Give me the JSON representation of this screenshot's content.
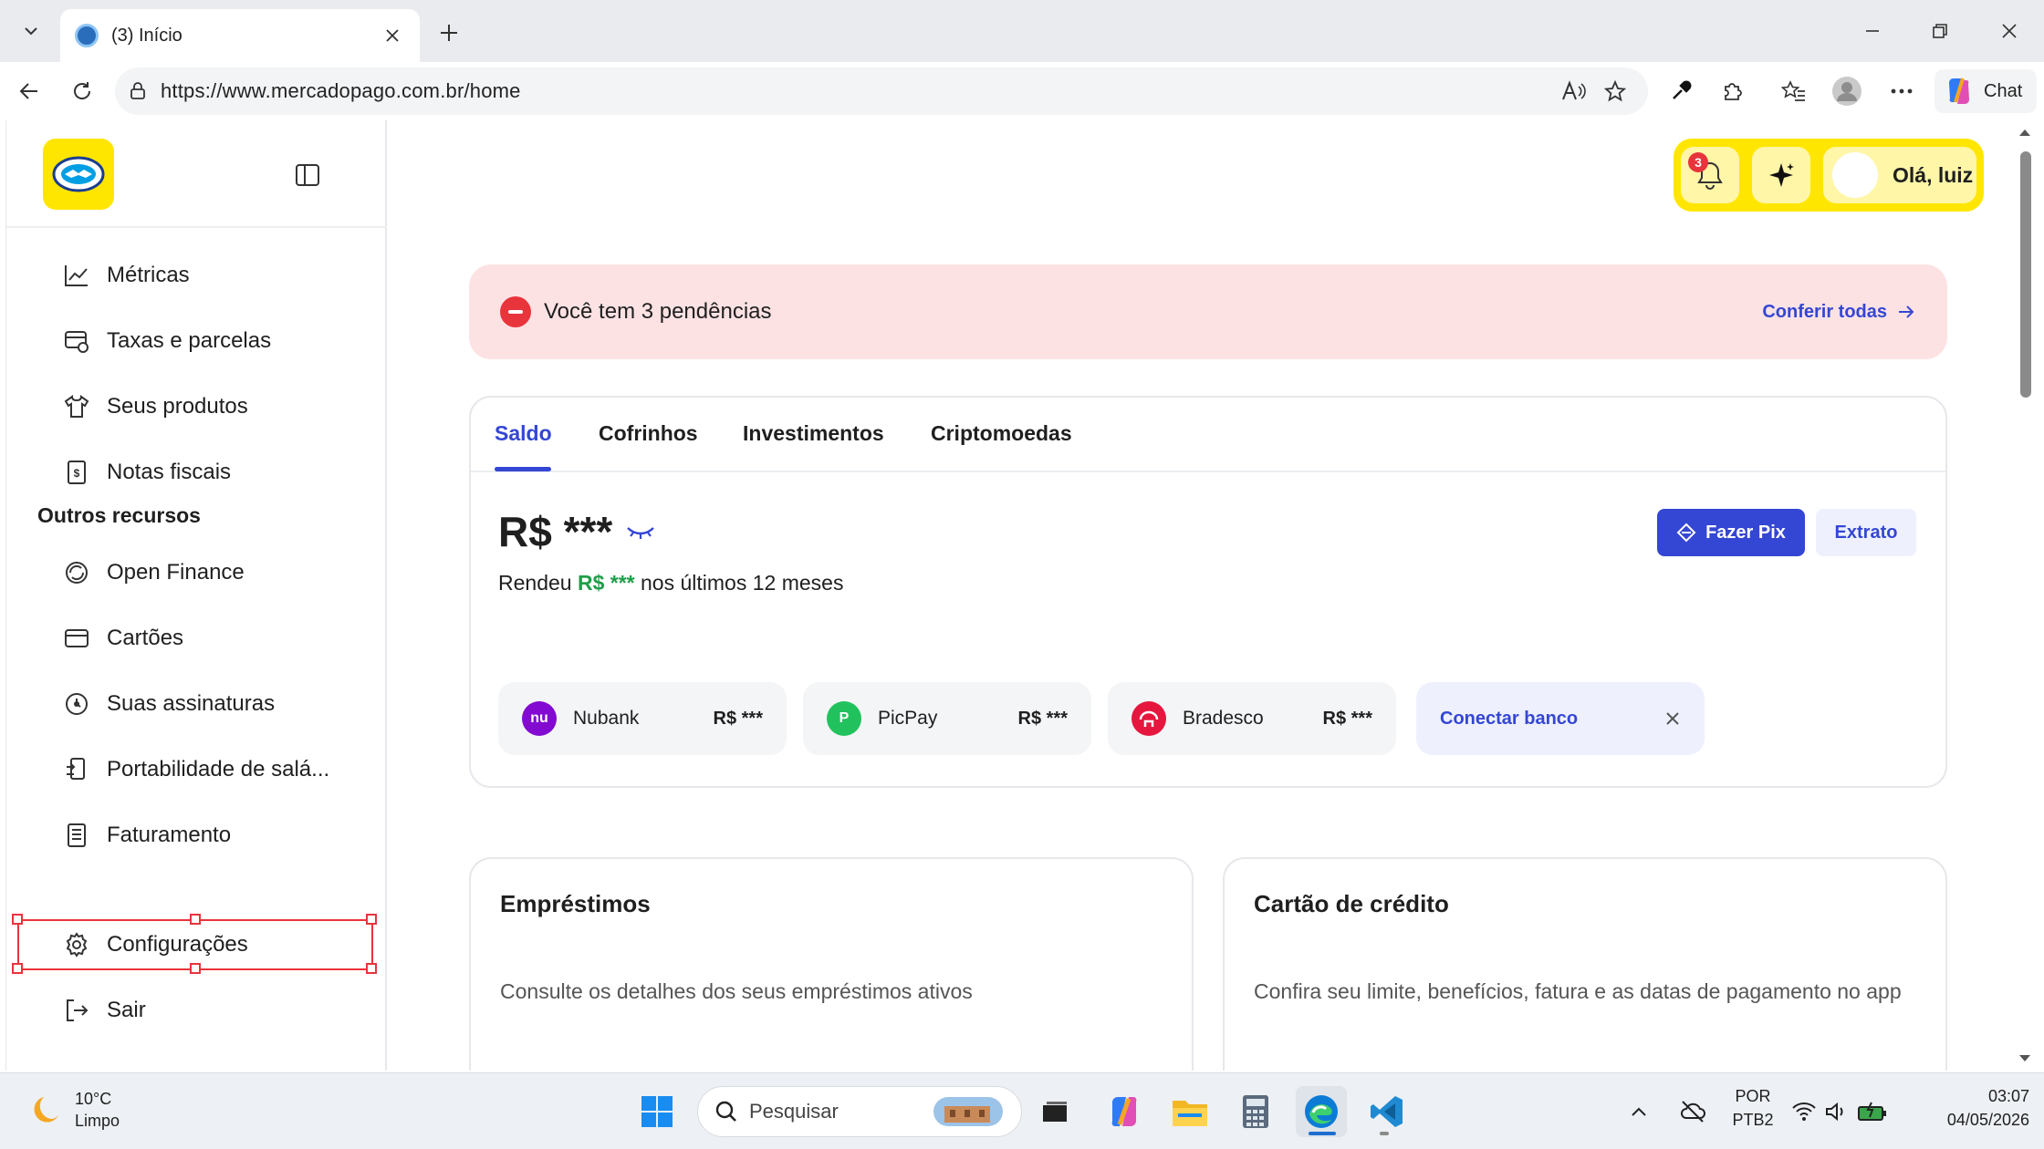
{
  "browser": {
    "tab_title": "(3) Início",
    "url": "https://www.mercadopago.com.br/home",
    "chat_label": "Chat"
  },
  "sidebar": {
    "items_top": [
      {
        "label": "Métricas",
        "icon": "chart-line-icon"
      },
      {
        "label": "Taxas e parcelas",
        "icon": "fees-icon"
      },
      {
        "label": "Seus produtos",
        "icon": "shirt-icon"
      },
      {
        "label": "Notas fiscais",
        "icon": "invoice-icon"
      }
    ],
    "section_heading": "Outros recursos",
    "items_other": [
      {
        "label": "Open Finance",
        "icon": "open-finance-icon"
      },
      {
        "label": "Cartões",
        "icon": "card-icon"
      },
      {
        "label": "Suas assinaturas",
        "icon": "subscriptions-icon"
      },
      {
        "label": "Portabilidade de salá...",
        "icon": "portability-icon"
      },
      {
        "label": "Faturamento",
        "icon": "billing-icon"
      }
    ],
    "settings_label": "Configurações",
    "logout_label": "Sair"
  },
  "header": {
    "notification_count": "3",
    "greeting": "Olá, luiz"
  },
  "alert": {
    "text": "Você tem 3 pendências",
    "link": "Conferir todas"
  },
  "balance_card": {
    "tabs": [
      "Saldo",
      "Cofrinhos",
      "Investimentos",
      "Criptomoedas"
    ],
    "active_tab": "Saldo",
    "balance": "R$ ***",
    "yield_prefix": "Rendeu",
    "yield_value": "R$ ***",
    "yield_suffix": "nos últimos 12 meses",
    "pix_button": "Fazer Pix",
    "statement_button": "Extrato",
    "banks": [
      {
        "name": "Nubank",
        "value": "R$ ***",
        "color": "#820ad1"
      },
      {
        "name": "PicPay",
        "value": "R$ ***",
        "color": "#21c25e"
      },
      {
        "name": "Bradesco",
        "value": "R$ ***",
        "color": "#e5173f"
      }
    ],
    "connect_label": "Conectar banco"
  },
  "cards": {
    "loans_title": "Empréstimos",
    "loans_text": "Consulte os detalhes dos seus empréstimos ativos",
    "credit_title": "Cartão de crédito",
    "credit_text": "Confira seu limite, benefícios, fatura e as datas de pagamento no app"
  },
  "taskbar": {
    "temperature": "10°C",
    "weather": "Limpo",
    "search_placeholder": "Pesquisar",
    "lang_top": "POR",
    "lang_bottom": "PTB2",
    "time": "03:07",
    "date": "04/05/2026"
  },
  "colors": {
    "brand_yellow": "#ffe600",
    "accent_blue": "#3446d4",
    "alert_bg": "#fde2e4",
    "alert_red": "#e8343b"
  }
}
